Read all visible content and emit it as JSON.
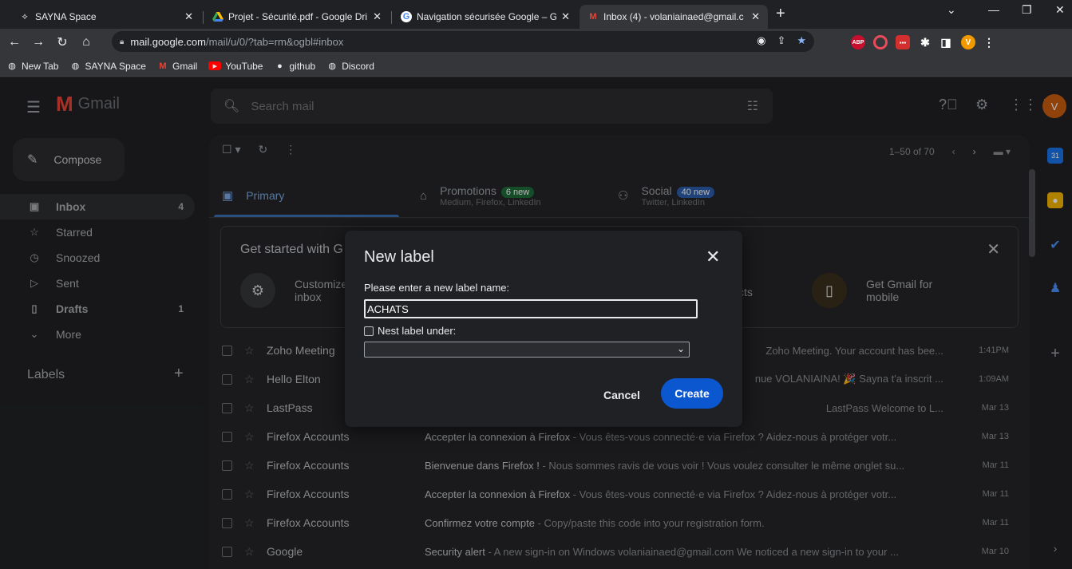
{
  "browser": {
    "tabs": [
      {
        "title": "SAYNA Space",
        "icon": "sayna-icon"
      },
      {
        "title": "Projet - Sécurité.pdf - Google Dri",
        "icon": "google-drive-icon"
      },
      {
        "title": "Navigation sécurisée Google – Go",
        "icon": "google-icon"
      },
      {
        "title": "Inbox (4) - volaniainaed@gmail.c",
        "icon": "gmail-icon"
      }
    ],
    "url_host": "mail.google.com",
    "url_path": "/mail/u/0/?tab=rm&ogbl#inbox",
    "profile_initial": "V",
    "bookmarks": [
      "New Tab",
      "SAYNA Space",
      "Gmail",
      "YouTube",
      "github",
      "Discord"
    ]
  },
  "gmail": {
    "logo_word": "Gmail",
    "search_placeholder": "Search mail",
    "avatar_initial": "V",
    "compose_label": "Compose",
    "nav": [
      {
        "label": "Inbox",
        "count": "4",
        "icon": "inbox-icon"
      },
      {
        "label": "Starred",
        "count": "",
        "icon": "star-icon"
      },
      {
        "label": "Snoozed",
        "count": "",
        "icon": "clock-icon"
      },
      {
        "label": "Sent",
        "count": "",
        "icon": "send-icon"
      },
      {
        "label": "Drafts",
        "count": "1",
        "icon": "draft-icon"
      },
      {
        "label": "More",
        "count": "",
        "icon": "chevron-down-icon"
      }
    ],
    "labels_heading": "Labels",
    "pager_text": "1–50 of 70",
    "categories": {
      "primary": {
        "label": "Primary"
      },
      "promotions": {
        "label": "Promotions",
        "badge": "6 new",
        "sub": "Medium, Firefox, LinkedIn"
      },
      "social": {
        "label": "Social",
        "badge": "40 new",
        "sub": "Twitter, LinkedIn"
      }
    },
    "get_started": {
      "title": "Get started with G",
      "card1": "Customize\ninbox",
      "card3": "cts",
      "card4_line1": "Get Gmail for",
      "card4_line2": "mobile"
    },
    "emails": [
      {
        "sender": "Zoho Meeting",
        "subject": "",
        "snippet": "Zoho Meeting. Your account has bee...",
        "date": "1:41PM"
      },
      {
        "sender": "Hello Elton",
        "subject": "",
        "snippet": "nue VOLANIAINA! 🎉 Sayna t'a inscrit ...",
        "date": "1:09AM"
      },
      {
        "sender": "LastPass",
        "subject": "",
        "snippet": "LastPass Welcome to L...",
        "date": "Mar 13"
      },
      {
        "sender": "Firefox Accounts",
        "subject": "Accepter la connexion à Firefox",
        "snippet": " - Vous êtes-vous connecté·e via Firefox ? Aidez-nous à protéger votr...",
        "date": "Mar 13"
      },
      {
        "sender": "Firefox Accounts",
        "subject": "Bienvenue dans Firefox !",
        "snippet": " - Nous sommes ravis de vous voir ! Vous voulez consulter le même onglet su...",
        "date": "Mar 11"
      },
      {
        "sender": "Firefox Accounts",
        "subject": "Accepter la connexion à Firefox",
        "snippet": " - Vous êtes-vous connecté·e via Firefox ? Aidez-nous à protéger votr...",
        "date": "Mar 11"
      },
      {
        "sender": "Firefox Accounts",
        "subject": "Confirmez votre compte",
        "snippet": " - Copy/paste this code into your registration form.",
        "date": "Mar 11"
      },
      {
        "sender": "Google",
        "subject": "Security alert",
        "snippet": " - A new sign-in on Windows volaniainaed@gmail.com We noticed a new sign-in to your ...",
        "date": "Mar 10"
      }
    ]
  },
  "dialog": {
    "title": "New label",
    "prompt": "Please enter a new label name:",
    "input_value": "ACHATS",
    "nest_label": "Nest label under:",
    "nest_checked": false,
    "cancel_label": "Cancel",
    "create_label": "Create"
  },
  "colors": {
    "accent_blue": "#0b57d0",
    "gmail_red": "#ea4335",
    "avatar": "#c65e10"
  }
}
